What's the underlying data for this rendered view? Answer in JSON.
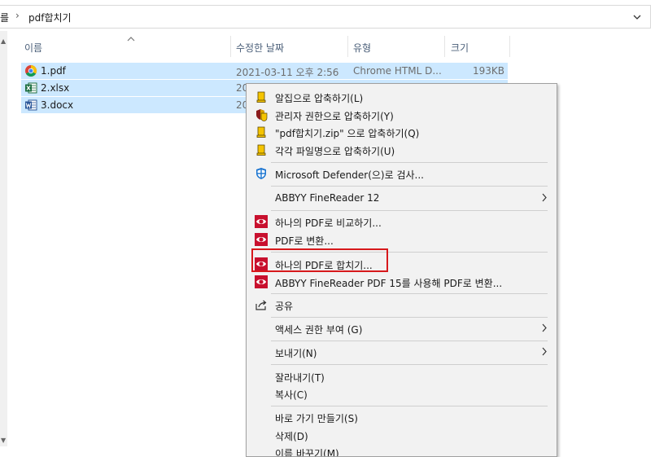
{
  "address": {
    "prev_crumb": "를",
    "separator": "›",
    "current_folder": "pdf합치기"
  },
  "columns": {
    "name": "이름",
    "modified": "수정한 날짜",
    "type": "유형",
    "size": "크기"
  },
  "files": [
    {
      "name": "1.pdf",
      "modified": "2021-03-11 오후 2:56",
      "type": "Chrome HTML D...",
      "size": "193KB",
      "icon": "chrome-icon"
    },
    {
      "name": "2.xlsx",
      "modified": "20",
      "type": "",
      "size": "",
      "icon": "excel-icon"
    },
    {
      "name": "3.docx",
      "modified": "20",
      "type": "",
      "size": "",
      "icon": "word-icon"
    }
  ],
  "menu": {
    "items": [
      {
        "label": "알집으로 압축하기(L)",
        "icon": "alzip-icon"
      },
      {
        "label": "관리자 권한으로 압축하기(Y)",
        "icon": "alzip-shield-icon"
      },
      {
        "label": "\"pdf합치기.zip\" 으로 압축하기(Q)",
        "icon": "alzip-icon"
      },
      {
        "label": "각각 파일명으로 압축하기(U)",
        "icon": "alzip-icon"
      },
      {
        "label": "Microsoft Defender(으)로 검사...",
        "icon": "defender-icon"
      },
      {
        "label": "ABBYY FineReader 12",
        "icon": "",
        "submenu": true
      },
      {
        "label": "하나의 PDF로 비교하기...",
        "icon": "abbyy-icon"
      },
      {
        "label": "PDF로 변환...",
        "icon": "abbyy-icon"
      },
      {
        "label": "하나의 PDF로 합치기...",
        "icon": "abbyy-icon"
      },
      {
        "label": "ABBYY FineReader PDF 15를 사용해 PDF로 변환...",
        "icon": "abbyy-icon"
      },
      {
        "label": "공유",
        "icon": "share-icon"
      },
      {
        "label": "액세스 권한 부여 (G)",
        "icon": "",
        "submenu": true
      },
      {
        "label": "보내기(N)",
        "icon": "",
        "submenu": true
      },
      {
        "label": "잘라내기(T)",
        "icon": ""
      },
      {
        "label": "복사(C)",
        "icon": ""
      },
      {
        "label": "바로 가기 만들기(S)",
        "icon": ""
      },
      {
        "label": "삭제(D)",
        "icon": ""
      },
      {
        "label": "이름 바꾸기(M)",
        "icon": ""
      }
    ]
  },
  "colors": {
    "selection": "#cce8ff",
    "menu_bg": "#f2f2f2",
    "highlight_box": "#d7191c",
    "abbyy_red": "#c8102e",
    "alzip_yellow": "#f5c400"
  }
}
